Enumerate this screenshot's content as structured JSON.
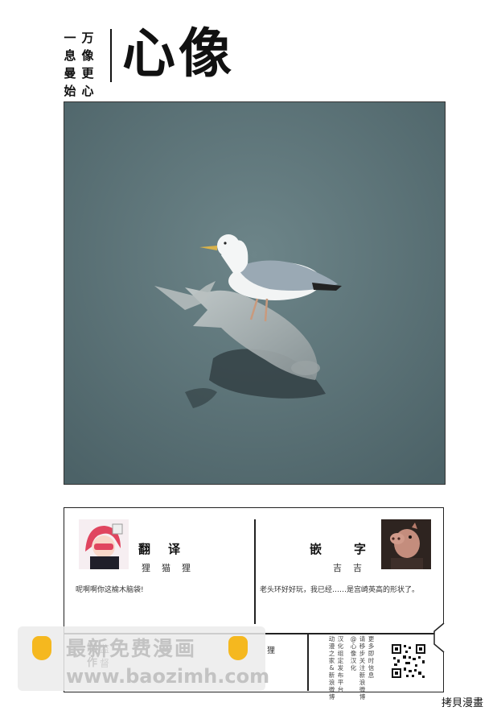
{
  "header": {
    "slogan_col1": "一息尚始",
    "slogan_col2": "万像更心",
    "slogan_col1_display": [
      "一",
      "息",
      "曼",
      "始"
    ],
    "slogan_col2_display": [
      "万",
      "像",
      "更",
      "心"
    ],
    "logo": "心像"
  },
  "photo": {
    "subject": "seagull-on-fish",
    "water_color": "#5d7479"
  },
  "credits": {
    "translator_role": "翻译",
    "translator_name": "狸猫狸",
    "translator_comment": "呢啊啊你这榆木脑袋!",
    "typesetter_role": "嵌字",
    "typesetter_name": "吉吉",
    "typesetter_comment": "老头环好好玩，我已经……是宫崎英高的形状了。",
    "producer_role": "制作",
    "producer_sub": "监督",
    "producer_name": "狸",
    "notice_col1": [
      "汉",
      "化",
      "组",
      "定",
      "发",
      "布",
      "平",
      "台"
    ],
    "notice_col2": [
      "动",
      "漫",
      "之",
      "家",
      "&",
      "新",
      "浪",
      "微",
      "博"
    ],
    "notice_col3": [
      "@",
      "心",
      "像",
      "汉",
      "化"
    ],
    "notice_col4": [
      "请",
      "移",
      "步",
      "关",
      "注",
      "新",
      "浪",
      "微",
      "博"
    ],
    "notice_col5": [
      "更",
      "多",
      "即",
      "时",
      "信",
      "息"
    ]
  },
  "watermark": {
    "line1": "最新免费漫画",
    "line2": "www.baozimh.com"
  },
  "footer": {
    "copyright": "拷貝漫畫"
  }
}
